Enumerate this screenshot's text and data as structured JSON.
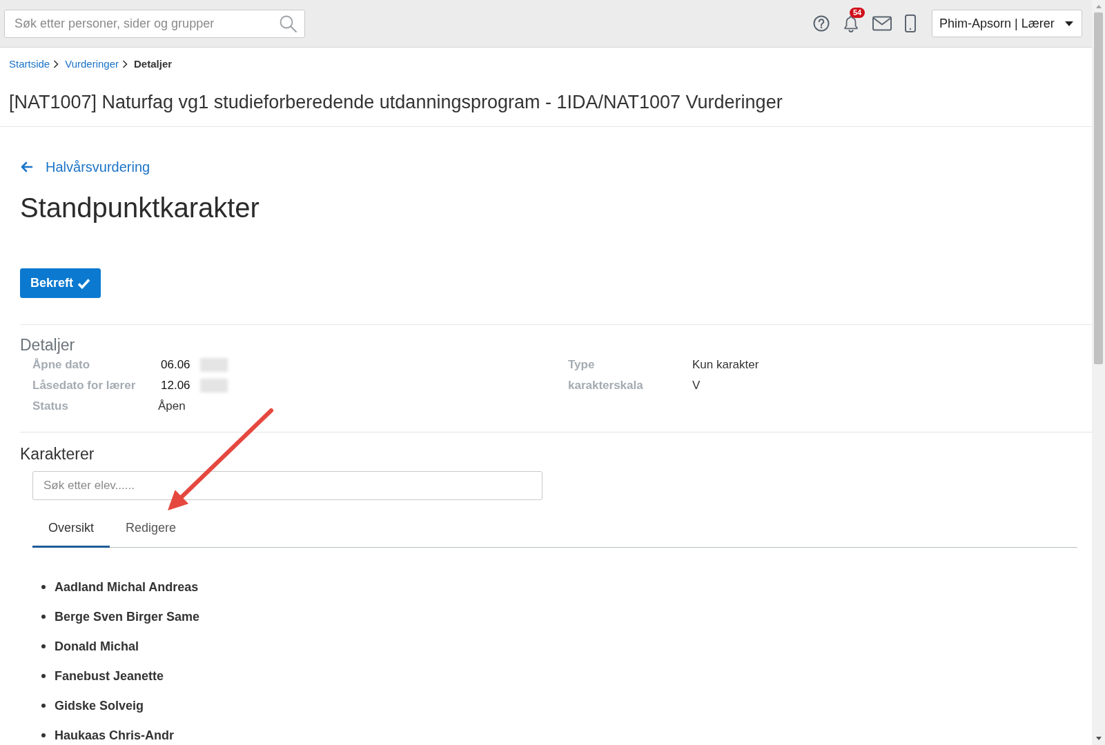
{
  "top_bar": {
    "search": {
      "placeholder": "Søk etter personer, sider og grupper"
    },
    "notifications": {
      "count": "54"
    },
    "user_menu": {
      "label": "Phim-Apsorn | Lærer"
    }
  },
  "breadcrumb": [
    {
      "label": "Startside",
      "current": false
    },
    {
      "label": "Vurderinger",
      "current": false
    },
    {
      "label": "Detaljer",
      "current": true
    }
  ],
  "page_title": "[NAT1007] Naturfag vg1 studieforberedende utdanningsprogram - 1IDA/NAT1007 Vurderinger",
  "back_link": {
    "label": "Halvårsvurdering"
  },
  "heading": "Standpunktkarakter",
  "confirm_button": {
    "label": "Bekreft"
  },
  "details": {
    "title": "Detaljer",
    "columns": [
      {
        "fields": [
          {
            "label": "Åpne dato",
            "value": "06.06",
            "redacted": true
          },
          {
            "label": "Låsedato for lærer",
            "value": "12.06",
            "redacted": true
          },
          {
            "label": "Status",
            "value": "Åpen",
            "redacted": false
          }
        ]
      },
      {
        "fields": [
          {
            "label": "Type",
            "value": "Kun karakter",
            "redacted": false
          },
          {
            "label": "karakterskala",
            "value": "V",
            "redacted": false
          }
        ]
      }
    ]
  },
  "grades": {
    "title": "Karakterer",
    "search": {
      "placeholder": "Søk etter elev......"
    },
    "tabs": [
      {
        "label": "Oversikt",
        "selected": true
      },
      {
        "label": "Redigere",
        "selected": false
      }
    ],
    "students": [
      "Aadland Michal Andreas",
      "Berge Sven Birger Same",
      "Donald Michal",
      "Fanebust Jeanette",
      "Gidske Solveig",
      "Haukaas Chris-Andr"
    ]
  }
}
